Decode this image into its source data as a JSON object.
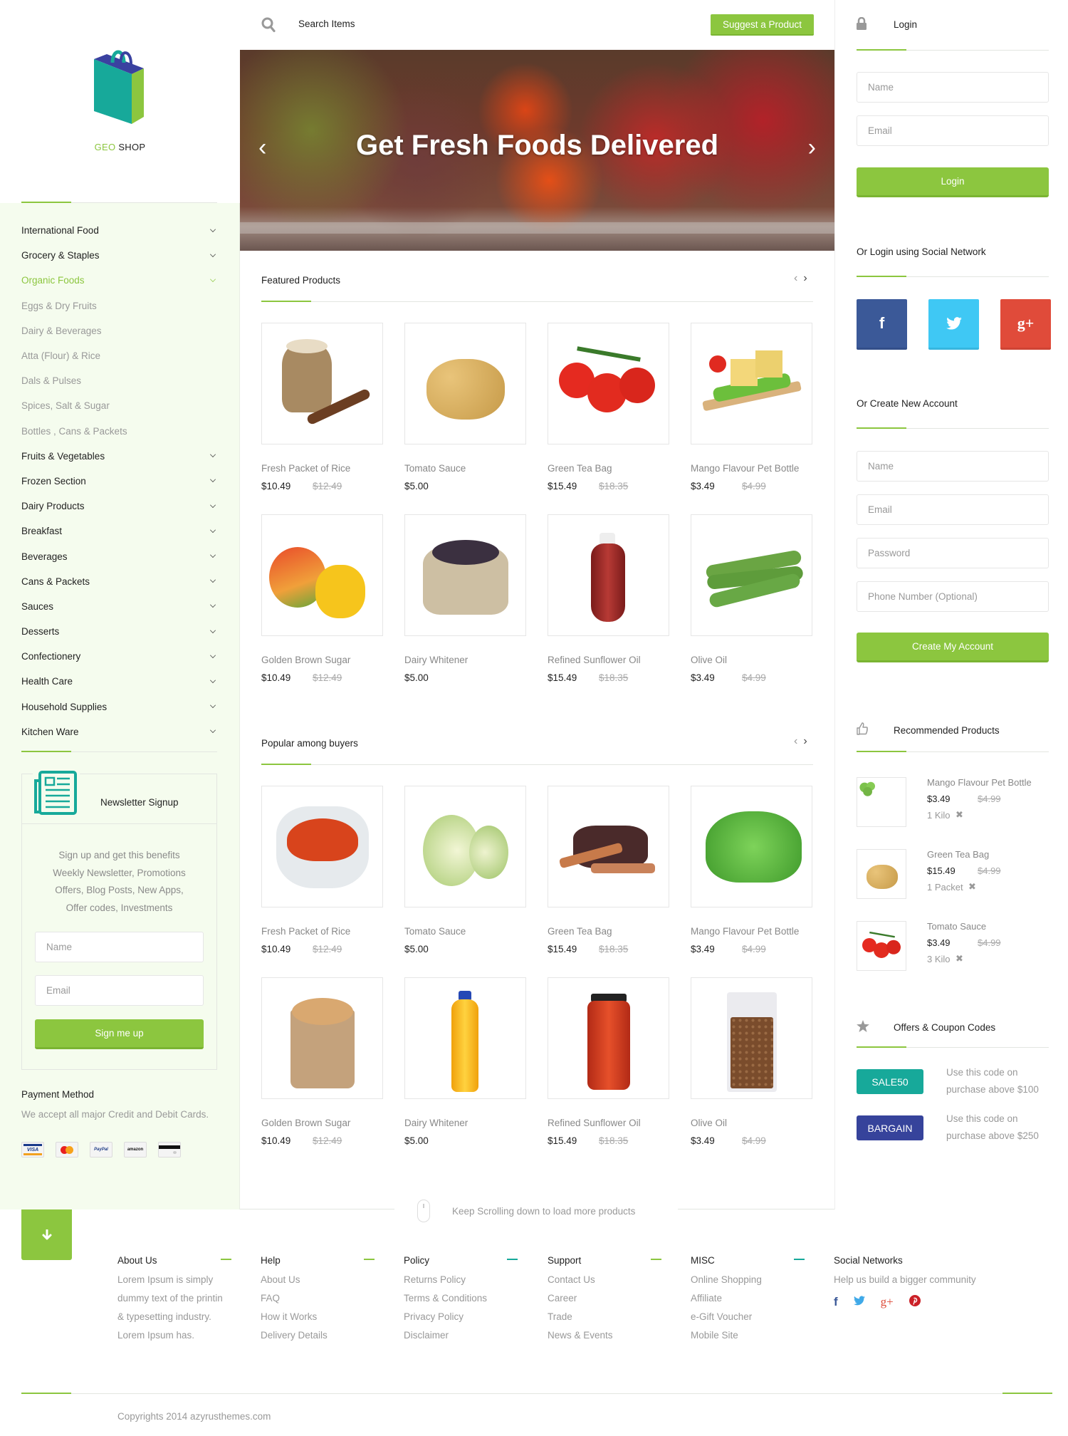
{
  "brand": {
    "name_accent": "GEO",
    "name_rest": "SHOP"
  },
  "header": {
    "search_placeholder": "Search Items",
    "suggest_button": "Suggest a Product"
  },
  "hero": {
    "title": "Get Fresh Foods Delivered",
    "prev_icon": "‹",
    "next_icon": "›"
  },
  "sidebar": {
    "categories": [
      {
        "label": "International Food",
        "type": "parent"
      },
      {
        "label": "Grocery & Staples",
        "type": "parent"
      },
      {
        "label": "Organic Foods",
        "type": "active"
      },
      {
        "label": "Eggs & Dry Fruits",
        "type": "sub"
      },
      {
        "label": "Dairy & Beverages",
        "type": "sub"
      },
      {
        "label": "Atta (Flour) & Rice",
        "type": "sub"
      },
      {
        "label": "Dals & Pulses",
        "type": "sub"
      },
      {
        "label": "Spices, Salt & Sugar",
        "type": "sub"
      },
      {
        "label": "Bottles , Cans & Packets",
        "type": "sub"
      },
      {
        "label": "Fruits & Vegetables",
        "type": "parent"
      },
      {
        "label": "Frozen Section",
        "type": "parent"
      },
      {
        "label": "Dairy Products",
        "type": "parent"
      },
      {
        "label": "Breakfast",
        "type": "parent"
      },
      {
        "label": "Beverages",
        "type": "parent"
      },
      {
        "label": "Cans & Packets",
        "type": "parent"
      },
      {
        "label": "Sauces",
        "type": "parent"
      },
      {
        "label": "Desserts",
        "type": "parent"
      },
      {
        "label": "Confectionery",
        "type": "parent"
      },
      {
        "label": "Health Care",
        "type": "parent"
      },
      {
        "label": "Household Supplies",
        "type": "parent"
      },
      {
        "label": "Kitchen Ware",
        "type": "parent"
      }
    ],
    "newsletter": {
      "title": "Newsletter Signup",
      "lines": [
        "Sign up and get this benefits",
        "Weekly Newsletter, Promotions",
        "Offers, Blog Posts, New Apps,",
        "Offer codes, Investments"
      ],
      "name_placeholder": "Name",
      "email_placeholder": "Email",
      "button": "Sign me up"
    },
    "payment": {
      "title": "Payment Method",
      "text": "We accept all major Credit and Debit Cards.",
      "cards": [
        "VISA",
        "MasterCard",
        "PayPal",
        "amazon",
        "Card"
      ]
    }
  },
  "sections": [
    {
      "title": "Featured Products",
      "products": [
        {
          "name": "Fresh Packet of Rice",
          "price": "$10.49",
          "old_price": "$12.49",
          "image": "rice-sack"
        },
        {
          "name": "Tomato Sauce",
          "price": "$5.00",
          "old_price": "",
          "image": "potatoes"
        },
        {
          "name": "Green Tea Bag",
          "price": "$15.49",
          "old_price": "$18.35",
          "image": "tomatoes"
        },
        {
          "name": "Mango Flavour Pet Bottle",
          "price": "$3.49",
          "old_price": "$4.99",
          "image": "cheese-board"
        },
        {
          "name": "Golden Brown Sugar",
          "price": "$10.49",
          "old_price": "$12.49",
          "image": "mangoes"
        },
        {
          "name": "Dairy Whitener",
          "price": "$5.00",
          "old_price": "",
          "image": "grain-sack"
        },
        {
          "name": "Refined Sunflower Oil",
          "price": "$15.49",
          "old_price": "$18.35",
          "image": "sauce-bottle"
        },
        {
          "name": "Olive Oil",
          "price": "$3.49",
          "old_price": "$4.99",
          "image": "okra"
        }
      ]
    },
    {
      "title": "Popular among buyers",
      "products": [
        {
          "name": "Fresh Packet of Rice",
          "price": "$10.49",
          "old_price": "$12.49",
          "image": "chili-powder"
        },
        {
          "name": "Tomato Sauce",
          "price": "$5.00",
          "old_price": "",
          "image": "cabbage"
        },
        {
          "name": "Green Tea Bag",
          "price": "$15.49",
          "old_price": "$18.35",
          "image": "spices"
        },
        {
          "name": "Mango Flavour Pet Bottle",
          "price": "$3.49",
          "old_price": "$4.99",
          "image": "lettuce"
        },
        {
          "name": "Golden Brown Sugar",
          "price": "$10.49",
          "old_price": "$12.49",
          "image": "chickpeas-bag"
        },
        {
          "name": "Dairy Whitener",
          "price": "$5.00",
          "old_price": "",
          "image": "oil-bottle"
        },
        {
          "name": "Refined Sunflower Oil",
          "price": "$15.49",
          "old_price": "$18.35",
          "image": "sauce-jar"
        },
        {
          "name": "Olive Oil",
          "price": "$3.49",
          "old_price": "$4.99",
          "image": "beans-bag"
        }
      ]
    }
  ],
  "scroll_hint": "Keep Scrolling down to load more products",
  "right": {
    "login": {
      "title": "Login",
      "name_placeholder": "Name",
      "email_placeholder": "Email",
      "button": "Login"
    },
    "social_login": {
      "title": "Or Login using Social Network",
      "buttons": [
        {
          "name": "facebook",
          "glyph": "f",
          "color": "#3b5998"
        },
        {
          "name": "twitter",
          "glyph": "🐦",
          "color": "#3fc8f4"
        },
        {
          "name": "google-plus",
          "glyph": "g+",
          "color": "#e04b3a"
        }
      ]
    },
    "register": {
      "title": "Or Create New Account",
      "name_placeholder": "Name",
      "email_placeholder": "Email",
      "password_placeholder": "Password",
      "phone_placeholder": "Phone Number (Optional)",
      "button": "Create My Account"
    },
    "recommended": {
      "title": "Recommended Products",
      "items": [
        {
          "name": "Mango Flavour Pet Bottle",
          "price": "$3.49",
          "old_price": "$4.99",
          "qty": "1 Kilo",
          "image": "brussels-sprouts"
        },
        {
          "name": "Green Tea Bag",
          "price": "$15.49",
          "old_price": "$4.99",
          "qty": "1 Packet",
          "image": "potatoes"
        },
        {
          "name": "Tomato Sauce",
          "price": "$3.49",
          "old_price": "$4.99",
          "qty": "3 Kilo",
          "image": "tomatoes"
        }
      ],
      "remove_glyph": "✖"
    },
    "offers": {
      "title": "Offers & Coupon Codes",
      "coupons": [
        {
          "code": "SALE50",
          "line1": "Use this code on",
          "line2": "purchase above $100",
          "color": "#17a99a"
        },
        {
          "code": "BARGAIN",
          "line1": "Use this code on",
          "line2": "purchase above $250",
          "color": "#36439b"
        }
      ]
    }
  },
  "footer": {
    "columns": [
      {
        "title": "About Us",
        "lines": [
          "Lorem Ipsum is simply",
          "dummy text of the printin",
          "& typesetting industry.",
          "Lorem Ipsum has."
        ],
        "links": false,
        "dash": "#8cc63f"
      },
      {
        "title": "Help",
        "lines": [
          "About Us",
          "FAQ",
          "How it Works",
          "Delivery Details"
        ],
        "links": true,
        "dash": "#8cc63f"
      },
      {
        "title": "Policy",
        "lines": [
          "Returns Policy",
          "Terms & Conditions",
          "Privacy Policy",
          "Disclaimer"
        ],
        "links": true,
        "dash": "#17a99a"
      },
      {
        "title": "Support",
        "lines": [
          "Contact Us",
          "Career",
          "Trade",
          "News & Events"
        ],
        "links": true,
        "dash": "#8cc63f"
      },
      {
        "title": "MISC",
        "lines": [
          "Online Shopping",
          "Affiliate",
          "e-Gift Voucher",
          "Mobile Site"
        ],
        "links": true,
        "dash": "#17a99a"
      }
    ],
    "social": {
      "title": "Social Networks",
      "text": "Help us build a bigger community",
      "icons": [
        {
          "name": "facebook",
          "glyph": "f",
          "color": "#3b5998"
        },
        {
          "name": "twitter",
          "glyph": "🐦",
          "color": "#3fa9e8"
        },
        {
          "name": "google-plus",
          "glyph": "g+",
          "color": "#dd4b39"
        },
        {
          "name": "pinterest",
          "glyph": "℗",
          "color": "#cb2027"
        }
      ]
    },
    "copyright": "Copyrights 2014 azyrusthemes.com"
  },
  "colors": {
    "accent": "#8cc63f",
    "teal": "#17a99a",
    "navy": "#36439b",
    "sidebar_bg": "#f5fcee"
  }
}
